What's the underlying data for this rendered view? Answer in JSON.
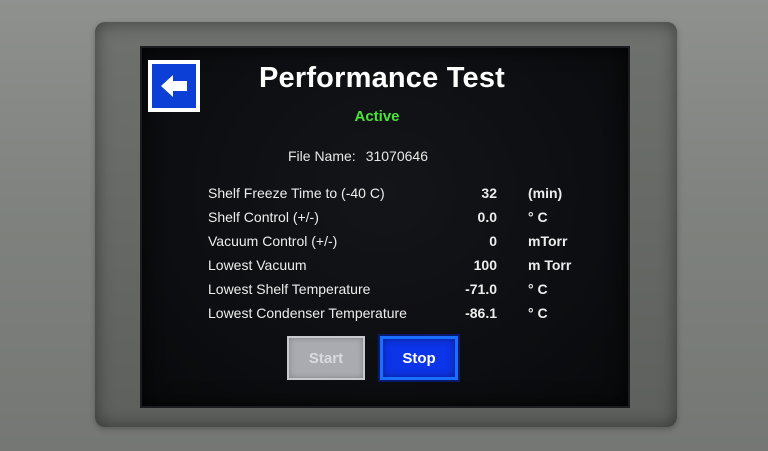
{
  "header": {
    "title": "Performance Test",
    "status": "Active",
    "back_icon": "left-arrow-icon"
  },
  "file": {
    "label": "File Name:",
    "value": "31070646"
  },
  "parameters": [
    {
      "label": "Shelf Freeze Time to (-40 C)",
      "value": "32",
      "unit": "(min)"
    },
    {
      "label": "Shelf Control (+/-)",
      "value": "0.0",
      "unit": "° C"
    },
    {
      "label": "Vacuum Control (+/-)",
      "value": "0",
      "unit": "mTorr"
    },
    {
      "label": "Lowest Vacuum",
      "value": "100",
      "unit": "m Torr"
    },
    {
      "label": "Lowest Shelf Temperature",
      "value": "-71.0",
      "unit": "° C"
    },
    {
      "label": "Lowest Condenser Temperature",
      "value": "-86.1",
      "unit": "° C"
    }
  ],
  "buttons": {
    "start_label": "Start",
    "stop_label": "Stop"
  },
  "colors": {
    "status_active": "#4be33a",
    "stop_button": "#0c34e8",
    "back_button": "#0b3fd6",
    "start_disabled": "#a9abb0"
  }
}
